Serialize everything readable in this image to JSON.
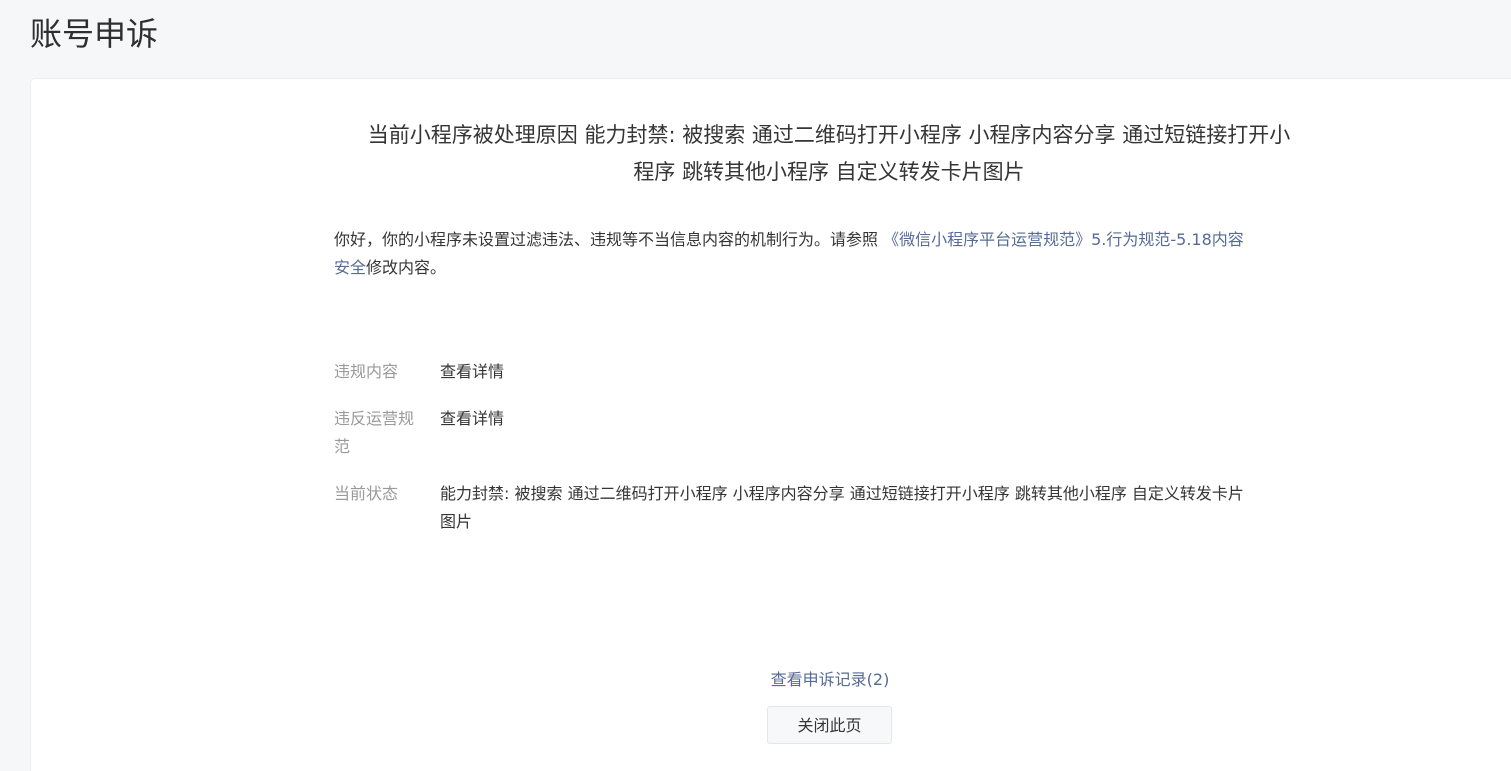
{
  "page": {
    "title": "账号申诉"
  },
  "headline": {
    "line1": "当前小程序被处理原因 能力封禁: 被搜索 通过二维码打开小程序 小程序内容分享 通过短链接打开小",
    "line2": "程序 跳转其他小程序 自定义转发卡片图片"
  },
  "notice": {
    "line1_prefix": "你好，你的小程序未设置过滤违法、违规等不当信息内容的机制行为。请参照 ",
    "line1_link": "《微信小程序平台运营规范》5.行为规范-5.18内容",
    "line2_link": "安全",
    "line2_suffix": "修改内容。"
  },
  "details": {
    "violation_content": {
      "label": "违规内容",
      "value": "查看详情"
    },
    "violated_rule": {
      "label_line1": "违反运营规",
      "label_line2": "范",
      "value": "查看详情"
    },
    "current_status": {
      "label": "当前状态",
      "value_line1": "能力封禁: 被搜索 通过二维码打开小程序 小程序内容分享 通过短链接打开小程序 跳转其他小程序 自定义转发卡片",
      "value_line2": "图片"
    }
  },
  "footer": {
    "records_link": "查看申诉记录(2)",
    "close_button": "关闭此页"
  },
  "colors": {
    "background": "#f6f7f9",
    "panel": "#ffffff",
    "text": "#353535",
    "muted_label": "#9a9a9a",
    "link": "#576b95"
  }
}
